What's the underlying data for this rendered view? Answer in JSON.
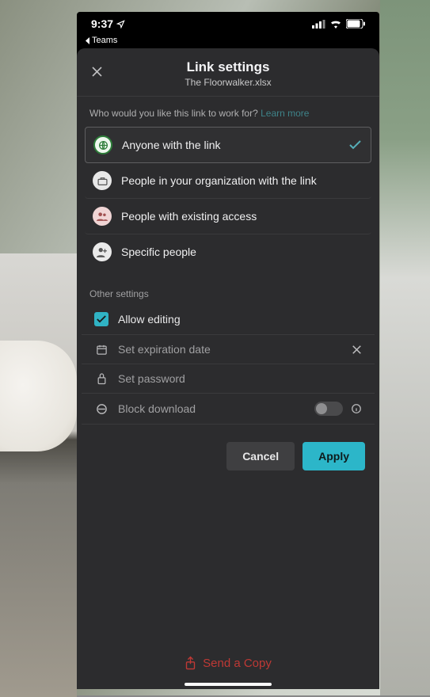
{
  "status": {
    "time": "9:37",
    "back_app": "Teams"
  },
  "header": {
    "title": "Link settings",
    "subtitle": "The Floorwalker.xlsx"
  },
  "prompt": {
    "text": "Who would you like this link to work for?",
    "learn_more": "Learn more"
  },
  "link_options": {
    "anyone": "Anyone with the link",
    "org": "People in your organization with the link",
    "existing": "People with existing access",
    "specific": "Specific people"
  },
  "other": {
    "section_label": "Other settings",
    "allow_editing": "Allow editing",
    "expiration": "Set expiration date",
    "password": "Set password",
    "block_download": "Block download"
  },
  "actions": {
    "cancel": "Cancel",
    "apply": "Apply"
  },
  "footer": {
    "send_copy": "Send a Copy"
  }
}
